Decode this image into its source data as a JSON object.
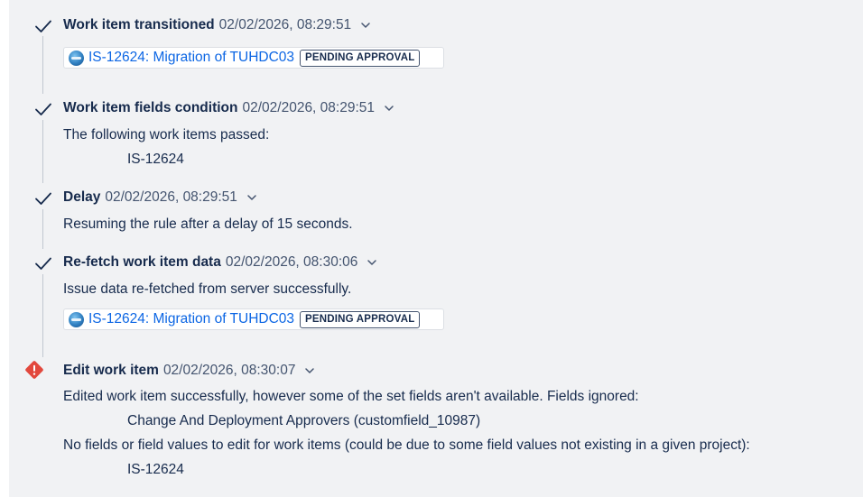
{
  "colors": {
    "accent_link": "#0c66e4",
    "error": "#e2483d",
    "panel_bg": "#f1f2f4"
  },
  "steps": [
    {
      "status": "success",
      "icon": "check-icon",
      "title": "Work item transitioned",
      "timestamp": "02/02/2026, 08:29:51",
      "issue": {
        "label": "IS-12624: Migration of TUHDC03",
        "status": "PENDING APPROVAL"
      }
    },
    {
      "status": "success",
      "icon": "check-icon",
      "title": "Work item fields condition",
      "timestamp": "02/02/2026, 08:29:51",
      "message": "The following work items passed:",
      "items": [
        "IS-12624"
      ]
    },
    {
      "status": "success",
      "icon": "check-icon",
      "title": "Delay",
      "timestamp": "02/02/2026, 08:29:51",
      "message": "Resuming the rule after a delay of 15 seconds."
    },
    {
      "status": "success",
      "icon": "check-icon",
      "title": "Re-fetch work item data",
      "timestamp": "02/02/2026, 08:30:06",
      "message": "Issue data re-fetched from server successfully.",
      "issue": {
        "label": "IS-12624: Migration of TUHDC03",
        "status": "PENDING APPROVAL"
      }
    },
    {
      "status": "error",
      "icon": "error-diamond-icon",
      "title": "Edit work item",
      "timestamp": "02/02/2026, 08:30:07",
      "message": "Edited work item successfully, however some of the set fields aren't available. Fields ignored:",
      "ignored_fields": [
        "Change And Deployment Approvers (customfield_10987)"
      ],
      "message2": "No fields or field values to edit for work items (could be due to some field values not existing in a given project):",
      "items": [
        "IS-12624"
      ]
    }
  ]
}
